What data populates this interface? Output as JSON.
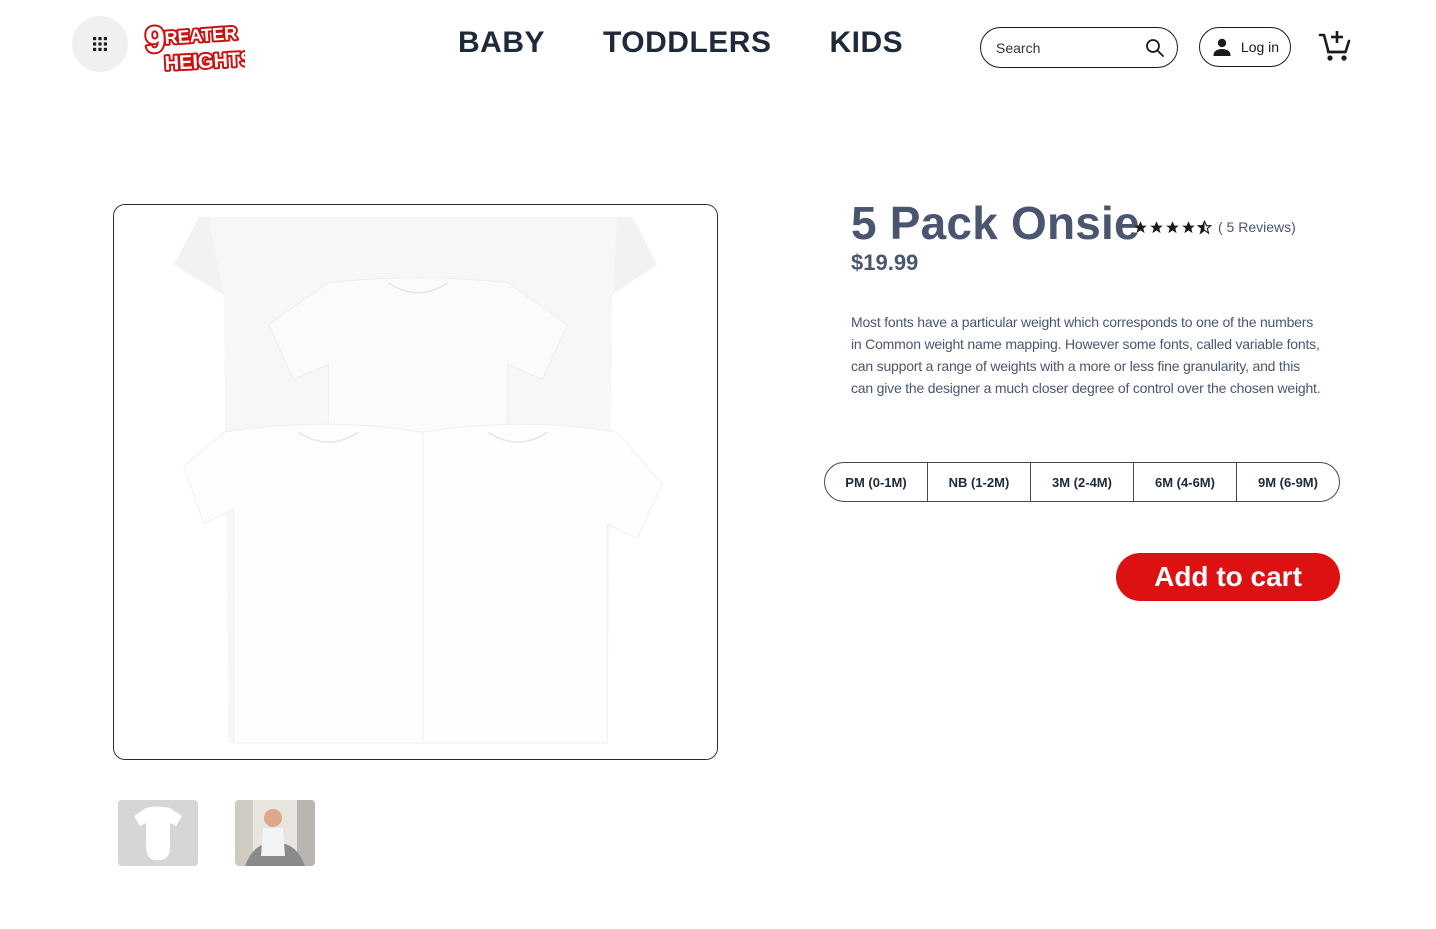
{
  "header": {
    "menu_icon": "grid-icon",
    "logo_text": "GREATER HEIGHTS",
    "nav": [
      "BABY",
      "TODDLERS",
      "KIDS"
    ],
    "search_placeholder": "Search",
    "search_icon": "search-icon",
    "login_label": "Log in",
    "login_icon": "user-icon",
    "cart_icon": "cart-add-icon"
  },
  "product": {
    "title": "5 Pack Onsie",
    "rating": 4.5,
    "reviews_label": "( 5 Reviews)",
    "price": "$19.99",
    "description": "Most fonts have a particular weight which corresponds to one of the numbers in Common weight name mapping. However some fonts, called variable fonts, can support a range of weights with a more or less fine granularity, and this can give the designer a much closer degree of control over the chosen weight.",
    "sizes": [
      "PM (0-1M)",
      "NB (1-2M)",
      "3M (2-4M)",
      "6M (4-6M)",
      "9M (6-9M)"
    ],
    "add_to_cart_label": "Add to cart"
  },
  "colors": {
    "accent": "#dd1111",
    "title": "#4a5670",
    "nav": "#1e2a3a"
  }
}
